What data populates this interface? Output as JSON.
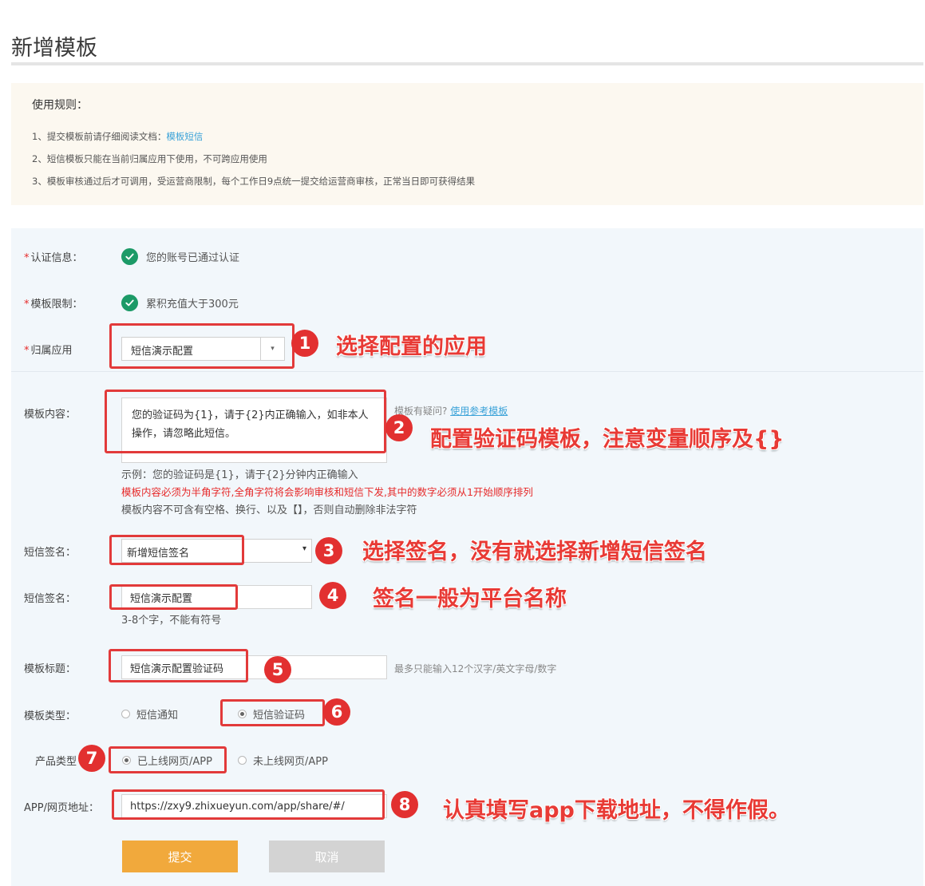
{
  "page": {
    "title": "新增模板"
  },
  "rules": {
    "title": "使用规则：",
    "item1_prefix": "1、提交模板前请仔细阅读文档：",
    "item1_link": "模板短信",
    "item2": "2、短信模板只能在当前归属应用下使用，不可跨应用使用",
    "item3": "3、模板审核通过后才可调用，受运营商限制，每个工作日9点统一提交给运营商审核，正常当日即可获得结果"
  },
  "form": {
    "required_mark": "*",
    "auth": {
      "label": "认证信息：",
      "value": "您的账号已通过认证"
    },
    "limit": {
      "label": "模板限制：",
      "value": "累积充值大于300元"
    },
    "app": {
      "label": "归属应用",
      "selected": "短信演示配置",
      "arrow": "▾"
    },
    "content": {
      "label": "模板内容：",
      "value": "您的验证码为{1}，请于{2}内正确输入，如非本人操作，请忽略此短信。",
      "hint": "模板有疑问?",
      "hint_link": "使用参考模板",
      "example": "示例：您的验证码是{1}，请于{2}分钟内正确输入",
      "warning": "模板内容必须为半角字符,全角字符将会影响审核和短信下发,其中的数字必须从1开始顺序排列",
      "rule": "模板内容不可含有空格、换行、以及【】，否则自动删除非法字符"
    },
    "sign_select": {
      "label": "短信签名：",
      "selected": "新增短信签名",
      "arrow": "▾"
    },
    "sign_input": {
      "label": "短信签名：",
      "value": "短信演示配置",
      "hint": "3-8个字，不能有符号"
    },
    "title_field": {
      "label": "模板标题：",
      "value": "短信演示配置验证码",
      "hint": "最多只能输入12个汉字/英文字母/数字"
    },
    "type": {
      "label": "模板类型：",
      "options": [
        "短信通知",
        "短信验证码"
      ],
      "selected": "短信验证码"
    },
    "product": {
      "label": "产品类型",
      "options": [
        "已上线网页/APP",
        "未上线网页/APP"
      ],
      "selected": "已上线网页/APP"
    },
    "url": {
      "label": "APP/网页地址：",
      "value": "https://zxy9.zhixueyun.com/app/share/#/"
    },
    "submit_label": "提交",
    "cancel_label": "取消"
  },
  "annotations": {
    "badges": [
      "1",
      "2",
      "3",
      "4",
      "5",
      "6",
      "7",
      "8"
    ],
    "text1": "选择配置的应用",
    "text2": "配置验证码模板，注意变量顺序及{}",
    "text3": "选择签名，没有就选择新增短信签名",
    "text4": "签名一般为平台名称",
    "text8": "认真填写app下载地址，不得作假。"
  },
  "colors": {
    "accent_red": "#e23a3a",
    "check_green": "#1c9a67",
    "submit": "#f1a93c",
    "link": "#3aa2d8"
  }
}
